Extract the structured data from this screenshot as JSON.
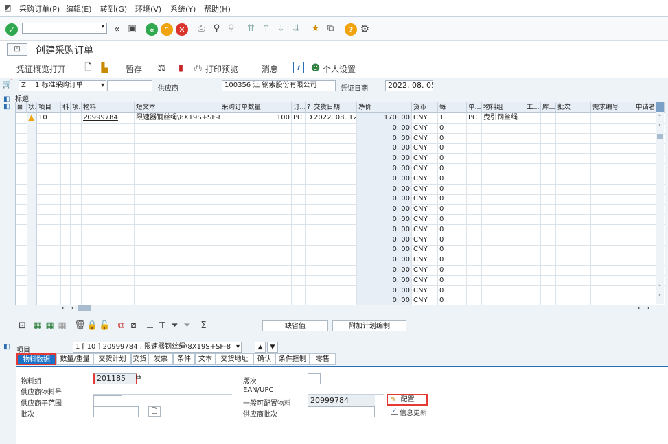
{
  "menu": [
    "采购订单(P)",
    "编辑(E)",
    "转到(G)",
    "环境(V)",
    "系统(Y)",
    "帮助(H)"
  ],
  "title": "创建采购订单",
  "app_toolbar": {
    "overview": "凭证概览打开",
    "hold": "暂存",
    "print_preview": "打印预览",
    "messages": "消息",
    "personal_settings": "个人设置"
  },
  "header": {
    "doc_type_code": "Z",
    "doc_type_text": "1 标准采购订单",
    "vendor_label": "供应商",
    "vendor_value": "100356 江   钢索股份有限公司",
    "doc_date_label": "凭证日期",
    "doc_date_value": "2022. 08. 05",
    "header_section": "标题"
  },
  "grid": {
    "columns": [
      "状.",
      "项目",
      "科",
      "项.",
      "物料",
      "短文本",
      "采购订单数量",
      "订...",
      "?",
      "交货日期",
      "净价",
      "货币",
      "每",
      "单...",
      "物料组",
      "工...",
      "库...",
      "批次",
      "需求编号",
      "申请者"
    ],
    "rows": [
      {
        "item": "10",
        "material": "20999784",
        "short_text": "限速器钢丝绳\\8X19S+SF-8",
        "qty": "100",
        "unit": "PC",
        "d": "D",
        "delivery_date": "2022. 08. 12",
        "net_price": "170. 00",
        "currency": "CNY",
        "per": "1",
        "unit2": "PC",
        "mat_group": "曳引钢丝绳"
      },
      {
        "net_price": "0. 00",
        "currency": "CNY",
        "per": "0"
      },
      {
        "net_price": "0. 00",
        "currency": "CNY",
        "per": "0"
      },
      {
        "net_price": "0. 00",
        "currency": "CNY",
        "per": "0"
      },
      {
        "net_price": "0. 00",
        "currency": "CNY",
        "per": "0"
      },
      {
        "net_price": "0. 00",
        "currency": "CNY",
        "per": "0"
      },
      {
        "net_price": "0. 00",
        "currency": "CNY",
        "per": "0"
      },
      {
        "net_price": "0. 00",
        "currency": "CNY",
        "per": "0"
      },
      {
        "net_price": "0. 00",
        "currency": "CNY",
        "per": "0"
      },
      {
        "net_price": "0. 00",
        "currency": "CNY",
        "per": "0"
      },
      {
        "net_price": "0. 00",
        "currency": "CNY",
        "per": "0"
      },
      {
        "net_price": "0. 00",
        "currency": "CNY",
        "per": "0"
      },
      {
        "net_price": "0. 00",
        "currency": "CNY",
        "per": "0"
      },
      {
        "net_price": "0. 00",
        "currency": "CNY",
        "per": "0"
      },
      {
        "net_price": "0. 00",
        "currency": "CNY",
        "per": "0"
      },
      {
        "net_price": "0. 00",
        "currency": "CNY",
        "per": "0"
      },
      {
        "net_price": "0. 00",
        "currency": "CNY",
        "per": "0"
      },
      {
        "net_price": "0. 00",
        "currency": "CNY",
        "per": "0"
      },
      {
        "net_price": "0. 00",
        "currency": "CNY",
        "per": "0"
      }
    ]
  },
  "grid_buttons": {
    "default_values": "缺省值",
    "additional_planning": "附加计划编制"
  },
  "item_detail": {
    "label": "项目",
    "selected": "1 [ 10 ] 20999784 , 限速器钢丝绳\\8X19S+SF-8",
    "tabs": [
      "物料数据",
      "数量/重量",
      "交货计划",
      "交货",
      "发票",
      "条件",
      "文本",
      "交货地址",
      "确认",
      "条件控制",
      "零售"
    ],
    "fields": {
      "mat_group_label": "物料组",
      "mat_group_value": "201185",
      "vendor_mat_label": "供应商物料号",
      "vendor_subrange_label": "供应商子范围",
      "batch_label": "批次",
      "revision_label": "版次",
      "ean_label": "EAN/UPC",
      "configurable_label": "一般可配置物料",
      "configurable_value": "20999784",
      "vendor_batch_label": "供应商批次",
      "config_button": "配置",
      "info_update_label": "信息更新"
    }
  }
}
